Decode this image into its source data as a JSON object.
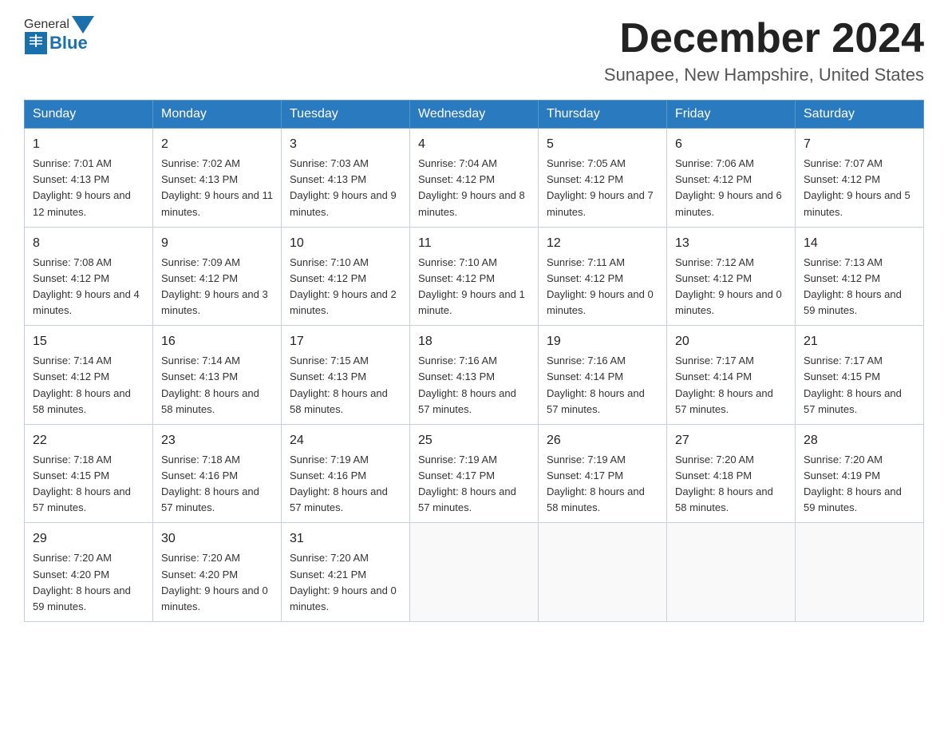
{
  "header": {
    "month_title": "December 2024",
    "location": "Sunapee, New Hampshire, United States",
    "logo_general": "General",
    "logo_blue": "Blue"
  },
  "weekdays": [
    "Sunday",
    "Monday",
    "Tuesday",
    "Wednesday",
    "Thursday",
    "Friday",
    "Saturday"
  ],
  "weeks": [
    [
      {
        "day": "1",
        "sunrise": "7:01 AM",
        "sunset": "4:13 PM",
        "daylight": "9 hours and 12 minutes."
      },
      {
        "day": "2",
        "sunrise": "7:02 AM",
        "sunset": "4:13 PM",
        "daylight": "9 hours and 11 minutes."
      },
      {
        "day": "3",
        "sunrise": "7:03 AM",
        "sunset": "4:13 PM",
        "daylight": "9 hours and 9 minutes."
      },
      {
        "day": "4",
        "sunrise": "7:04 AM",
        "sunset": "4:12 PM",
        "daylight": "9 hours and 8 minutes."
      },
      {
        "day": "5",
        "sunrise": "7:05 AM",
        "sunset": "4:12 PM",
        "daylight": "9 hours and 7 minutes."
      },
      {
        "day": "6",
        "sunrise": "7:06 AM",
        "sunset": "4:12 PM",
        "daylight": "9 hours and 6 minutes."
      },
      {
        "day": "7",
        "sunrise": "7:07 AM",
        "sunset": "4:12 PM",
        "daylight": "9 hours and 5 minutes."
      }
    ],
    [
      {
        "day": "8",
        "sunrise": "7:08 AM",
        "sunset": "4:12 PM",
        "daylight": "9 hours and 4 minutes."
      },
      {
        "day": "9",
        "sunrise": "7:09 AM",
        "sunset": "4:12 PM",
        "daylight": "9 hours and 3 minutes."
      },
      {
        "day": "10",
        "sunrise": "7:10 AM",
        "sunset": "4:12 PM",
        "daylight": "9 hours and 2 minutes."
      },
      {
        "day": "11",
        "sunrise": "7:10 AM",
        "sunset": "4:12 PM",
        "daylight": "9 hours and 1 minute."
      },
      {
        "day": "12",
        "sunrise": "7:11 AM",
        "sunset": "4:12 PM",
        "daylight": "9 hours and 0 minutes."
      },
      {
        "day": "13",
        "sunrise": "7:12 AM",
        "sunset": "4:12 PM",
        "daylight": "9 hours and 0 minutes."
      },
      {
        "day": "14",
        "sunrise": "7:13 AM",
        "sunset": "4:12 PM",
        "daylight": "8 hours and 59 minutes."
      }
    ],
    [
      {
        "day": "15",
        "sunrise": "7:14 AM",
        "sunset": "4:12 PM",
        "daylight": "8 hours and 58 minutes."
      },
      {
        "day": "16",
        "sunrise": "7:14 AM",
        "sunset": "4:13 PM",
        "daylight": "8 hours and 58 minutes."
      },
      {
        "day": "17",
        "sunrise": "7:15 AM",
        "sunset": "4:13 PM",
        "daylight": "8 hours and 58 minutes."
      },
      {
        "day": "18",
        "sunrise": "7:16 AM",
        "sunset": "4:13 PM",
        "daylight": "8 hours and 57 minutes."
      },
      {
        "day": "19",
        "sunrise": "7:16 AM",
        "sunset": "4:14 PM",
        "daylight": "8 hours and 57 minutes."
      },
      {
        "day": "20",
        "sunrise": "7:17 AM",
        "sunset": "4:14 PM",
        "daylight": "8 hours and 57 minutes."
      },
      {
        "day": "21",
        "sunrise": "7:17 AM",
        "sunset": "4:15 PM",
        "daylight": "8 hours and 57 minutes."
      }
    ],
    [
      {
        "day": "22",
        "sunrise": "7:18 AM",
        "sunset": "4:15 PM",
        "daylight": "8 hours and 57 minutes."
      },
      {
        "day": "23",
        "sunrise": "7:18 AM",
        "sunset": "4:16 PM",
        "daylight": "8 hours and 57 minutes."
      },
      {
        "day": "24",
        "sunrise": "7:19 AM",
        "sunset": "4:16 PM",
        "daylight": "8 hours and 57 minutes."
      },
      {
        "day": "25",
        "sunrise": "7:19 AM",
        "sunset": "4:17 PM",
        "daylight": "8 hours and 57 minutes."
      },
      {
        "day": "26",
        "sunrise": "7:19 AM",
        "sunset": "4:17 PM",
        "daylight": "8 hours and 58 minutes."
      },
      {
        "day": "27",
        "sunrise": "7:20 AM",
        "sunset": "4:18 PM",
        "daylight": "8 hours and 58 minutes."
      },
      {
        "day": "28",
        "sunrise": "7:20 AM",
        "sunset": "4:19 PM",
        "daylight": "8 hours and 59 minutes."
      }
    ],
    [
      {
        "day": "29",
        "sunrise": "7:20 AM",
        "sunset": "4:20 PM",
        "daylight": "8 hours and 59 minutes."
      },
      {
        "day": "30",
        "sunrise": "7:20 AM",
        "sunset": "4:20 PM",
        "daylight": "9 hours and 0 minutes."
      },
      {
        "day": "31",
        "sunrise": "7:20 AM",
        "sunset": "4:21 PM",
        "daylight": "9 hours and 0 minutes."
      },
      null,
      null,
      null,
      null
    ]
  ]
}
